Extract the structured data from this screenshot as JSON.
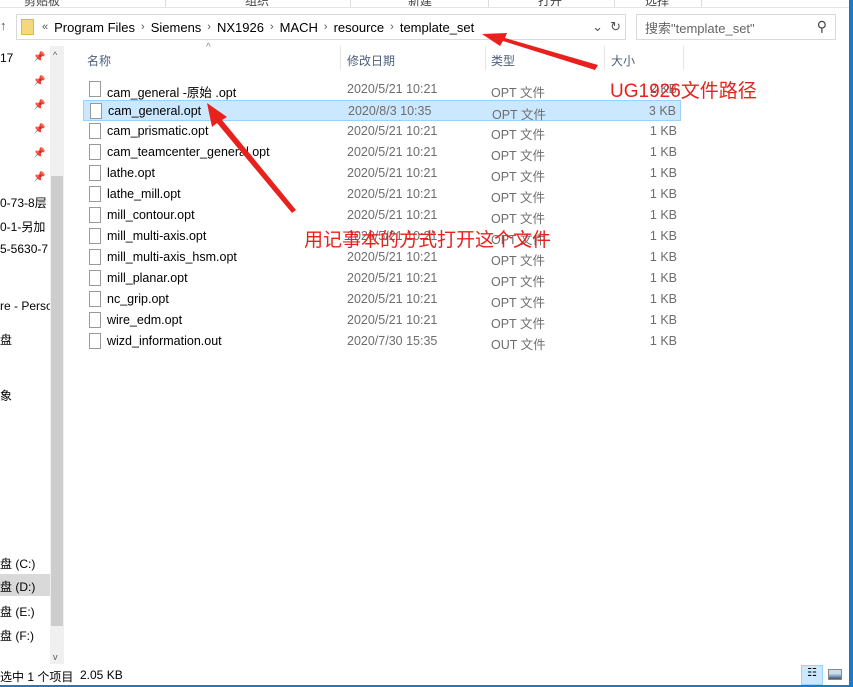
{
  "ribbon": {
    "groups": [
      "剪贴板",
      "组织",
      "新建",
      "打开",
      "选择"
    ]
  },
  "address": {
    "crumbs": [
      "Program Files",
      "Siemens",
      "NX1926",
      "MACH",
      "resource",
      "template_set"
    ],
    "overflow": "«"
  },
  "search": {
    "placeholder": "搜索\"template_set\""
  },
  "nav": {
    "items": [
      "17",
      "",
      "",
      "",
      "",
      "",
      "0-73-8层",
      "0-1-另加",
      "5-5630-7",
      "re - Perso",
      "盘",
      "象",
      "盘 (C:)",
      "盘 (D:)",
      "盘 (E:)",
      "盘 (F:)"
    ]
  },
  "columns": {
    "name": "名称",
    "date": "修改日期",
    "type": "类型",
    "size": "大小"
  },
  "files": [
    {
      "name": "cam_general -原始 .opt",
      "date": "2020/5/21 10:21",
      "type": "OPT 文件",
      "size": "2 KB"
    },
    {
      "name": "cam_general.opt",
      "date": "2020/8/3 10:35",
      "type": "OPT 文件",
      "size": "3 KB",
      "selected": true
    },
    {
      "name": "cam_prismatic.opt",
      "date": "2020/5/21 10:21",
      "type": "OPT 文件",
      "size": "1 KB"
    },
    {
      "name": "cam_teamcenter_general.opt",
      "date": "2020/5/21 10:21",
      "type": "OPT 文件",
      "size": "1 KB"
    },
    {
      "name": "lathe.opt",
      "date": "2020/5/21 10:21",
      "type": "OPT 文件",
      "size": "1 KB"
    },
    {
      "name": "lathe_mill.opt",
      "date": "2020/5/21 10:21",
      "type": "OPT 文件",
      "size": "1 KB"
    },
    {
      "name": "mill_contour.opt",
      "date": "2020/5/21 10:21",
      "type": "OPT 文件",
      "size": "1 KB"
    },
    {
      "name": "mill_multi-axis.opt",
      "date": "2020/5/21 10:21",
      "type": "OPT 文件",
      "size": "1 KB"
    },
    {
      "name": "mill_multi-axis_hsm.opt",
      "date": "2020/5/21 10:21",
      "type": "OPT 文件",
      "size": "1 KB"
    },
    {
      "name": "mill_planar.opt",
      "date": "2020/5/21 10:21",
      "type": "OPT 文件",
      "size": "1 KB"
    },
    {
      "name": "nc_grip.opt",
      "date": "2020/5/21 10:21",
      "type": "OPT 文件",
      "size": "1 KB"
    },
    {
      "name": "wire_edm.opt",
      "date": "2020/5/21 10:21",
      "type": "OPT 文件",
      "size": "1 KB"
    },
    {
      "name": "wizd_information.out",
      "date": "2020/7/30 15:35",
      "type": "OUT 文件",
      "size": "1 KB"
    }
  ],
  "status": {
    "selection": "选中 1 个项目",
    "size": "2.05 KB"
  },
  "annotations": {
    "path_note": "UG1926文件路径",
    "open_note": "用记事本的方式打开这个文件",
    "color": "#e8211d"
  },
  "colors": {
    "selection": "#cce8ff",
    "accent": "#1979ca"
  }
}
